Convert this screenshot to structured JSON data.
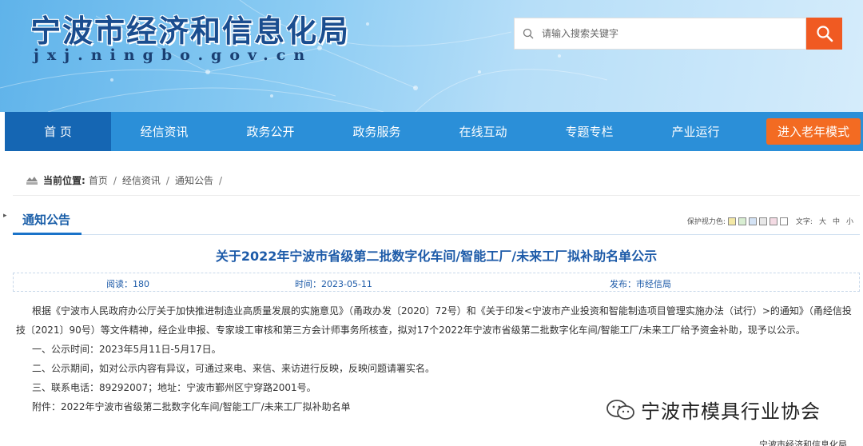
{
  "header": {
    "site_title": "宁波市经济和信息化局",
    "site_domain": "jxj.ningbo.gov.cn",
    "search_placeholder": "请输入搜索关键字"
  },
  "nav": {
    "items": [
      "首 页",
      "经信资讯",
      "政务公开",
      "政务服务",
      "在线互动",
      "专题专栏",
      "产业运行"
    ],
    "senior_mode": "进入老年模式"
  },
  "breadcrumb": {
    "label": "当前位置:",
    "items": [
      "首页",
      "经信资讯",
      "通知公告"
    ]
  },
  "section": {
    "title": "通知公告",
    "eye_care_label": "保护视力色:",
    "font_label": "文字:",
    "font_sizes": [
      "大",
      "中",
      "小"
    ],
    "swatch_colors": [
      "#f4e9a6",
      "#d8eed2",
      "#d4e3f5",
      "#e8e8e8",
      "#f4dbe4",
      "#ffffff"
    ]
  },
  "article": {
    "title": "关于2022年宁波市省级第二批数字化车间/智能工厂/未来工厂拟补助名单公示",
    "read_count": "阅读：180",
    "time": "时间：2023-05-11",
    "source": "发布：市经信局",
    "paragraphs": [
      "根据《宁波市人民政府办公厅关于加快推进制造业高质量发展的实施意见》（甬政办发〔2020〕72号）和《关于印发<宁波市产业投资和智能制造项目管理实施办法（试行）>的通知》（甬经信投技〔2021〕90号）等文件精神，经企业申报、专家竣工审核和第三方会计师事务所核查，拟对17个2022年宁波市省级第二批数字化车间/智能工厂/未来工厂给予资金补助，现予以公示。",
      "一、公示时间：2023年5月11日-5月17日。",
      "二、公示期间，如对公示内容有异议，可通过来电、来信、来访进行反映，反映问题请署实名。",
      "三、联系电话：89292007；地址：宁波市鄞州区宁穿路2001号。",
      "附件：2022年宁波市省级第二批数字化车间/智能工厂/未来工厂拟补助名单"
    ]
  },
  "watermark": "宁波市模具行业协会",
  "footer_peek": "宁波市经济和信息化局",
  "colors": {
    "nav_bg": "#2b8fd8",
    "nav_active": "#1566b3",
    "accent_orange": "#f05a22",
    "title_blue": "#1c5aa8"
  }
}
